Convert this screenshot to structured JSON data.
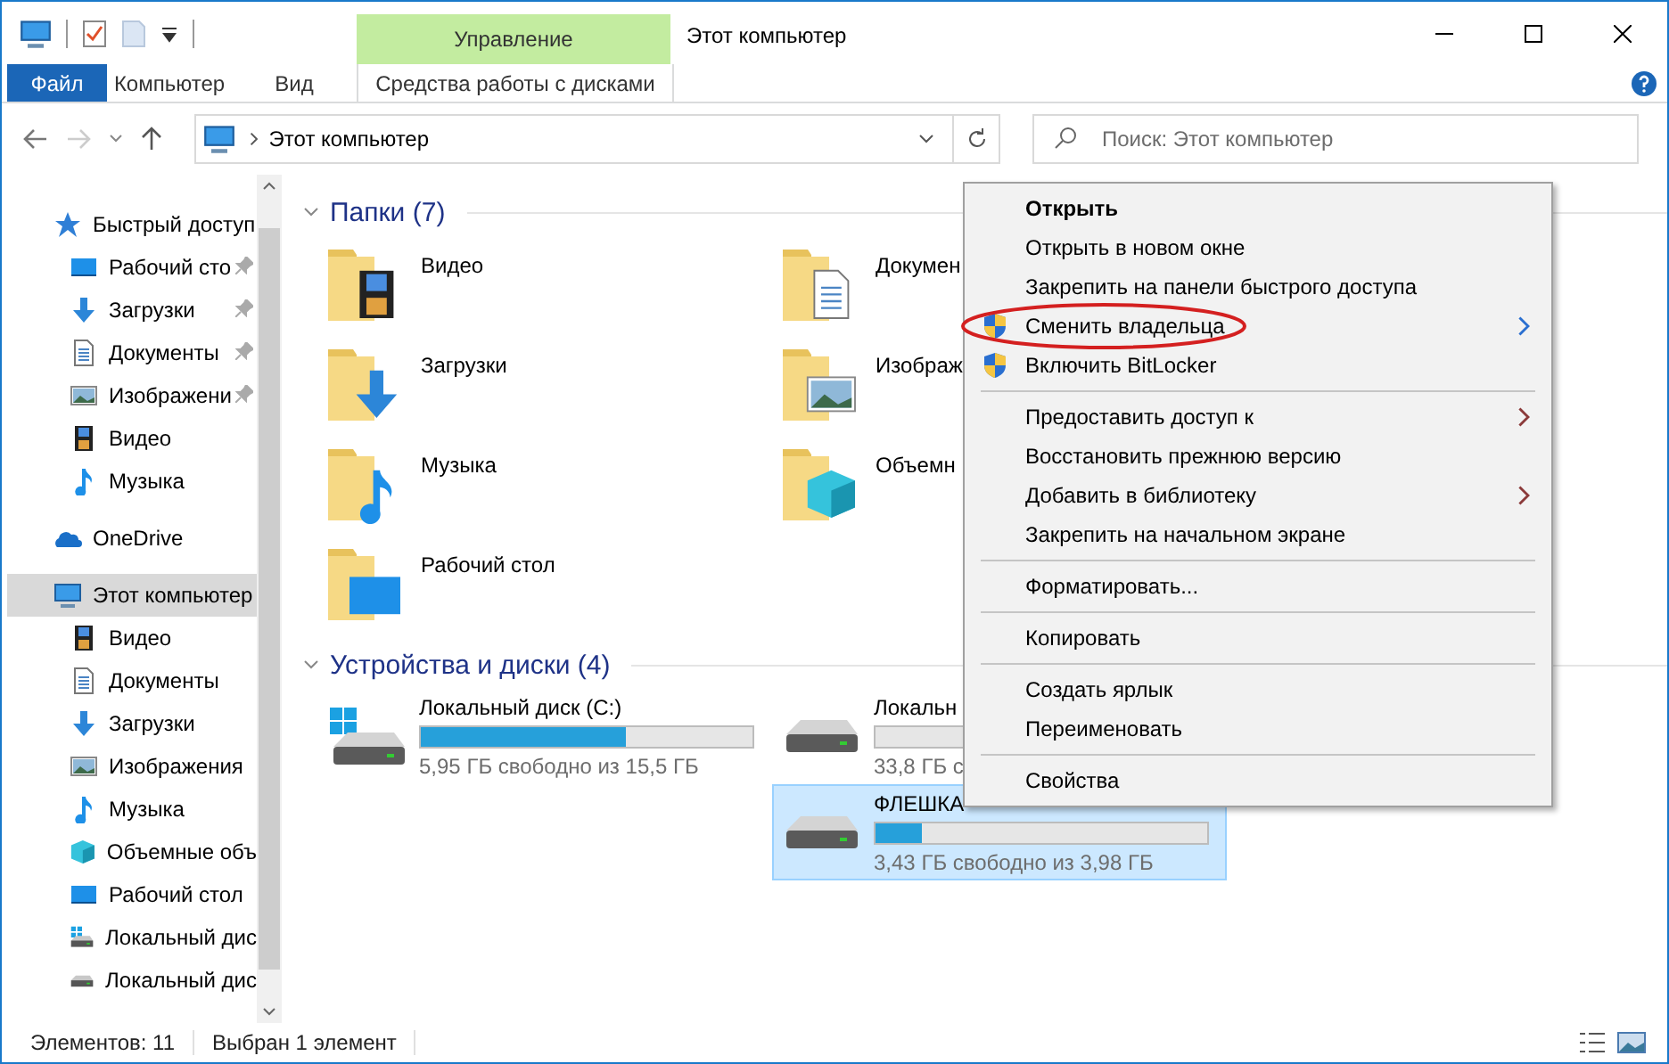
{
  "window": {
    "title": "Этот компьютер",
    "context_group": "Управление"
  },
  "ribbon": {
    "tabs": [
      {
        "label": "Файл",
        "kind": "file"
      },
      {
        "label": "Компьютер",
        "kind": "tab"
      },
      {
        "label": "Вид",
        "kind": "tab"
      },
      {
        "label": "Средства работы с дисками",
        "kind": "context"
      }
    ]
  },
  "address": {
    "path": "Этот компьютер",
    "search_placeholder": "Поиск: Этот компьютер"
  },
  "nav": [
    {
      "label": "Быстрый доступ",
      "kind": "star",
      "selected": false,
      "children": [
        {
          "label": "Рабочий сто",
          "kind": "desktop",
          "pinned": true
        },
        {
          "label": "Загрузки",
          "kind": "download",
          "pinned": true
        },
        {
          "label": "Документы",
          "kind": "doc",
          "pinned": true
        },
        {
          "label": "Изображени",
          "kind": "image",
          "pinned": true
        },
        {
          "label": "Видео",
          "kind": "video",
          "pinned": false
        },
        {
          "label": "Музыка",
          "kind": "music",
          "pinned": false
        }
      ]
    },
    {
      "label": "OneDrive",
      "kind": "cloud",
      "selected": false
    },
    {
      "label": "Этот компьютер",
      "kind": "pc",
      "selected": true,
      "children": [
        {
          "label": "Видео",
          "kind": "video",
          "pinned": false
        },
        {
          "label": "Документы",
          "kind": "doc",
          "pinned": false
        },
        {
          "label": "Загрузки",
          "kind": "download",
          "pinned": false
        },
        {
          "label": "Изображения",
          "kind": "image",
          "pinned": false
        },
        {
          "label": "Музыка",
          "kind": "music",
          "pinned": false
        },
        {
          "label": "Объемные объ",
          "kind": "cube",
          "pinned": false
        },
        {
          "label": "Рабочий стол",
          "kind": "desktop",
          "pinned": false
        },
        {
          "label": "Локальный дис",
          "kind": "windrive",
          "pinned": false
        },
        {
          "label": "Локальный дис",
          "kind": "drive",
          "pinned": false
        }
      ]
    }
  ],
  "folders": {
    "title": "Папки (7)",
    "items": [
      {
        "label": "Видео",
        "kind": "video"
      },
      {
        "label": "Докумен",
        "kind": "doc"
      },
      {
        "label": "Загрузки",
        "kind": "download"
      },
      {
        "label": "Изображ",
        "kind": "image"
      },
      {
        "label": "Музыка",
        "kind": "music"
      },
      {
        "label": "Объемн",
        "kind": "cube"
      },
      {
        "label": "Рабочий стол",
        "kind": "desktop"
      }
    ]
  },
  "drives": {
    "title": "Устройства и диски (4)",
    "items": [
      {
        "label": "Локальный диск (C:)",
        "kind": "windrive",
        "level": 0.62,
        "free": "5,95 ГБ свободно из 15,5 ГБ",
        "selected": false
      },
      {
        "label": "Локальн",
        "kind": "drive",
        "free": "33,8 ГБ с",
        "selected": false
      },
      {
        "label": "ФЛЕШКА",
        "kind": "drive",
        "level": 0.14,
        "free": "3,43 ГБ свободно из 3,98 ГБ",
        "selected": true
      }
    ]
  },
  "context_menu": [
    {
      "kind": "item",
      "label": "Открыть",
      "bold": true
    },
    {
      "kind": "item",
      "label": "Открыть в новом окне"
    },
    {
      "kind": "item",
      "label": "Закрепить на панели быстрого доступа"
    },
    {
      "kind": "item",
      "label": "Сменить владельца",
      "shield": true,
      "submenu": true,
      "circled": true
    },
    {
      "kind": "item",
      "label": "Включить BitLocker",
      "shield": true
    },
    {
      "kind": "separator"
    },
    {
      "kind": "item",
      "label": "Предоставить доступ к",
      "submenu": true
    },
    {
      "kind": "item",
      "label": "Восстановить прежнюю версию"
    },
    {
      "kind": "item",
      "label": "Добавить в библиотеку",
      "submenu": true
    },
    {
      "kind": "item",
      "label": "Закрепить на начальном экране"
    },
    {
      "kind": "separator"
    },
    {
      "kind": "item",
      "label": "Форматировать..."
    },
    {
      "kind": "separator"
    },
    {
      "kind": "item",
      "label": "Копировать"
    },
    {
      "kind": "separator"
    },
    {
      "kind": "item",
      "label": "Создать ярлык"
    },
    {
      "kind": "item",
      "label": "Переименовать"
    },
    {
      "kind": "separator"
    },
    {
      "kind": "item",
      "label": "Свойства"
    }
  ],
  "status": [
    "Элементов: 11",
    "Выбран 1 элемент"
  ]
}
